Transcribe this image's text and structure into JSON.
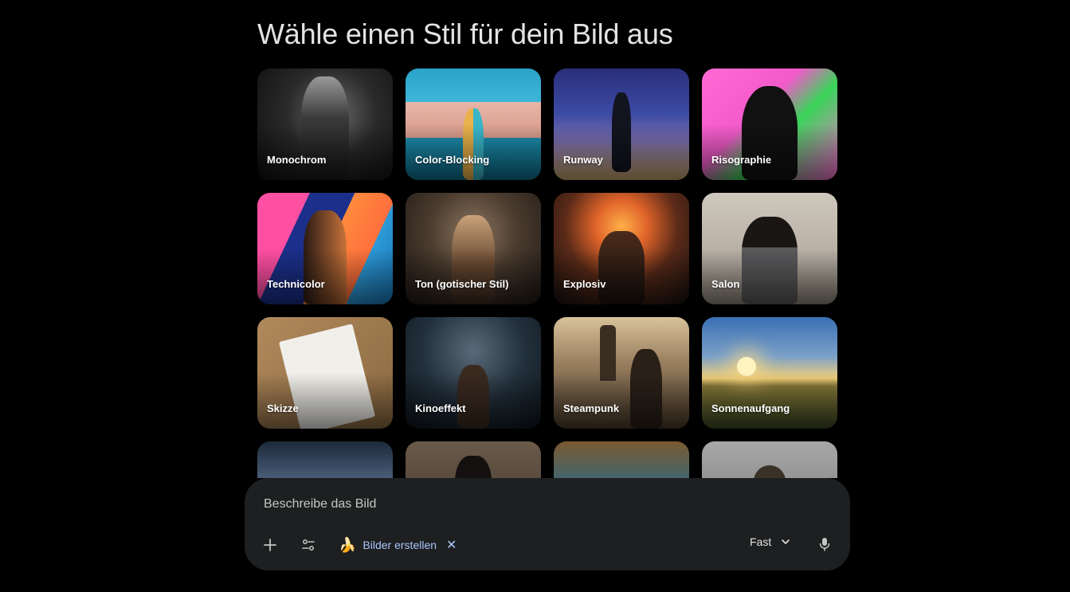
{
  "page": {
    "title": "Wähle einen Stil für dein Bild aus"
  },
  "styles": [
    {
      "label": "Monochrom"
    },
    {
      "label": "Color-Blocking"
    },
    {
      "label": "Runway"
    },
    {
      "label": "Risographie"
    },
    {
      "label": "Technicolor"
    },
    {
      "label": "Ton (gotischer Stil)"
    },
    {
      "label": "Explosiv"
    },
    {
      "label": "Salon"
    },
    {
      "label": "Skizze"
    },
    {
      "label": "Kinoeffekt"
    },
    {
      "label": "Steampunk"
    },
    {
      "label": "Sonnenaufgang"
    }
  ],
  "prompt": {
    "placeholder": "Beschreibe das Bild",
    "tool_chip": {
      "label": "Bilder erstellen",
      "icon": "banana-icon"
    },
    "model_selector": {
      "value": "Fast"
    },
    "icons": {
      "add": "plus-icon",
      "tools": "tune-icon",
      "close": "close-icon",
      "dropdown": "chevron-down-icon",
      "mic": "microphone-icon"
    }
  },
  "colors": {
    "background": "#000000",
    "prompt_bg": "#1e1f20",
    "chip_accent": "#a8c7fa",
    "text": "#e3e3e3"
  }
}
